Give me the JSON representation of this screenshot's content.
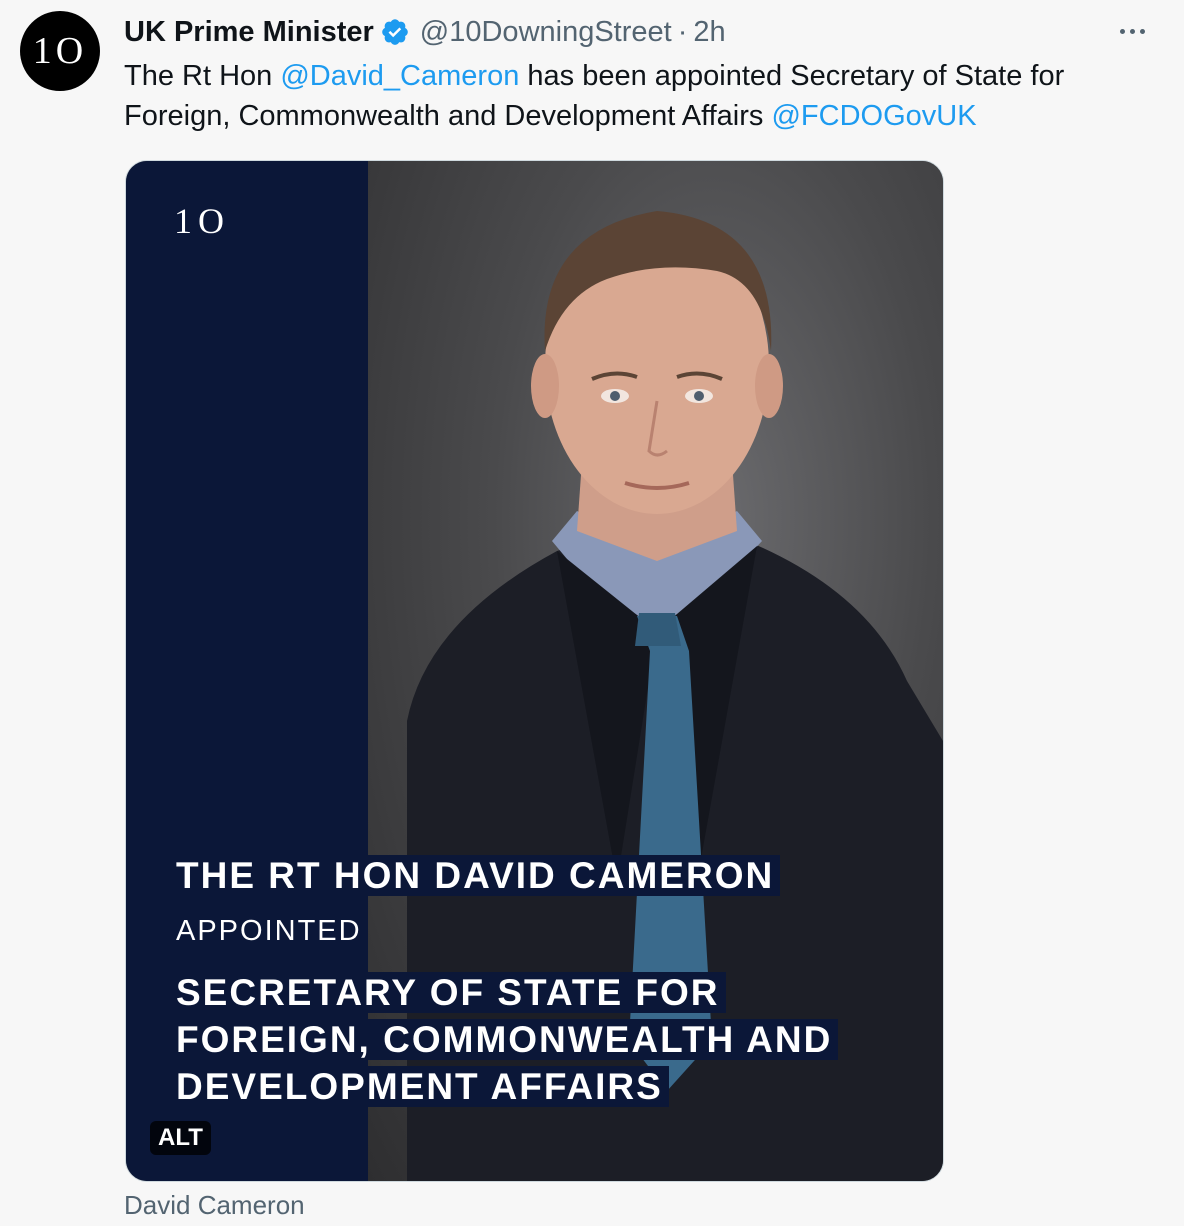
{
  "author": {
    "logo_text": "1O",
    "name": "UK Prime Minister",
    "handle": "@10DowningStreet",
    "separator": "·",
    "time": "2h"
  },
  "tweet": {
    "part1": "The Rt Hon ",
    "mention1": "@David_Cameron",
    "part2": " has been appointed Secretary of State for Foreign, Commonwealth and Development Affairs ",
    "mention2": "@FCDOGovUK"
  },
  "media": {
    "logo_text": "1O",
    "headline": "THE RT HON DAVID CAMERON",
    "subhead": "APPOINTED",
    "role": "SECRETARY OF STATE FOR FOREIGN, COMMONWEALTH AND DEVELOPMENT AFFAIRS",
    "alt_badge": "ALT",
    "label": "David Cameron"
  },
  "colors": {
    "mention": "#1d9bf0",
    "navy_panel": "#0b1738",
    "verified": "#1d9bf0"
  },
  "icons": {
    "verified": "verified-badge-icon",
    "more": "more-options-icon"
  }
}
